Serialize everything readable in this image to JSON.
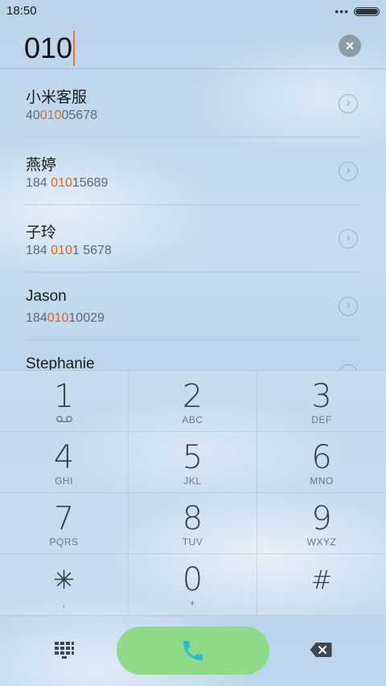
{
  "status_bar": {
    "time": "18:50",
    "dots": "•••"
  },
  "dialer": {
    "input": "010",
    "clear_icon": "×"
  },
  "results": [
    {
      "name": "小米客服",
      "number_parts": [
        "40",
        "010",
        "05678"
      ]
    },
    {
      "name": "燕婷",
      "number_parts": [
        "184 ",
        "010",
        "15689"
      ]
    },
    {
      "name": "子玲",
      "number_parts": [
        "184 ",
        "010",
        "1 5678"
      ]
    },
    {
      "name": "Jason",
      "number_parts": [
        "184",
        "010",
        "10029"
      ]
    },
    {
      "name": "Stephanie",
      "number_parts": [
        "",
        "",
        ""
      ]
    }
  ],
  "keypad": [
    {
      "digit": "1",
      "sub": "voicemail-icon"
    },
    {
      "digit": "2",
      "sub": "ABC"
    },
    {
      "digit": "3",
      "sub": "DEF"
    },
    {
      "digit": "4",
      "sub": "GHI"
    },
    {
      "digit": "5",
      "sub": "JKL"
    },
    {
      "digit": "6",
      "sub": "MNO"
    },
    {
      "digit": "7",
      "sub": "PQRS"
    },
    {
      "digit": "8",
      "sub": "TUV"
    },
    {
      "digit": "9",
      "sub": "WXYZ"
    },
    {
      "digit": "✳",
      "sub": ","
    },
    {
      "digit": "0",
      "sub": "+"
    },
    {
      "digit": "#",
      "sub": ""
    }
  ],
  "icons": {
    "detail": "chevron-right-icon",
    "keypad_toggle": "dialpad-icon",
    "call": "phone-icon",
    "backspace": "backspace-icon"
  },
  "colors": {
    "highlight": "#e5631c",
    "caret": "#f07a26",
    "call_button": "#8ddb86",
    "call_icon": "#23b9e6"
  }
}
